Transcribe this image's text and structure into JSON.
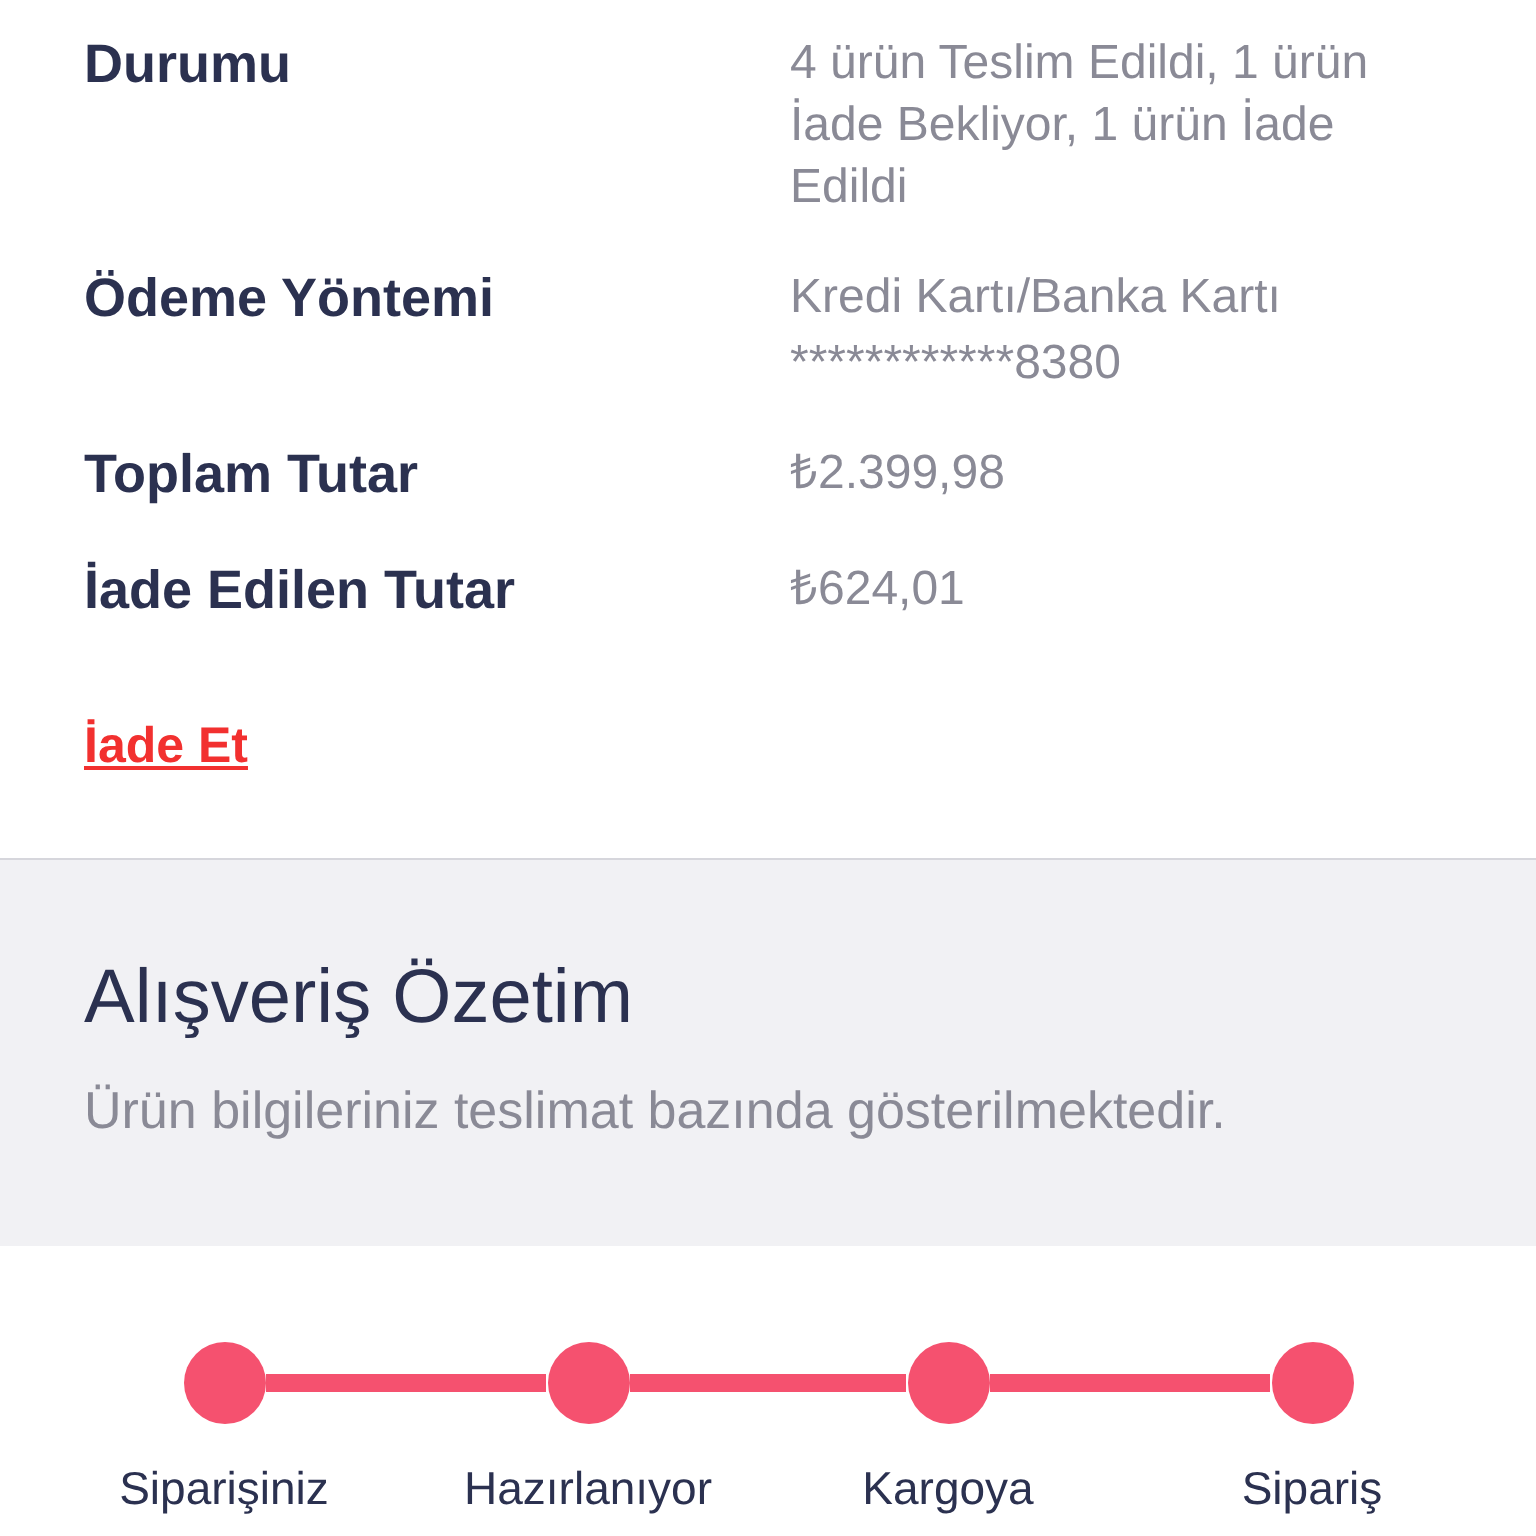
{
  "details": [
    {
      "label": "Durumu",
      "value": "4 ürün Teslim Edildi, 1 ürün İade Bekliyor, 1 ürün İade Edildi"
    },
    {
      "label": "Ödeme Yöntemi",
      "value": "Kredi Kartı/Banka Kartı",
      "card_number": "************8380"
    },
    {
      "label": "Toplam Tutar",
      "value": "₺2.399,98"
    },
    {
      "label": "İade Edilen Tutar",
      "value": "₺624,01"
    }
  ],
  "return_link": "İade Et",
  "summary": {
    "title": "Alışveriş Özetim",
    "subtitle": "Ürün bilgileriniz teslimat bazında gösterilmektedir."
  },
  "steps": [
    {
      "label": "Siparişiniz",
      "completed": true
    },
    {
      "label": "Hazırlanıyor",
      "completed": true
    },
    {
      "label": "Kargoya",
      "completed": true
    },
    {
      "label": "Sipariş",
      "completed": true
    }
  ]
}
